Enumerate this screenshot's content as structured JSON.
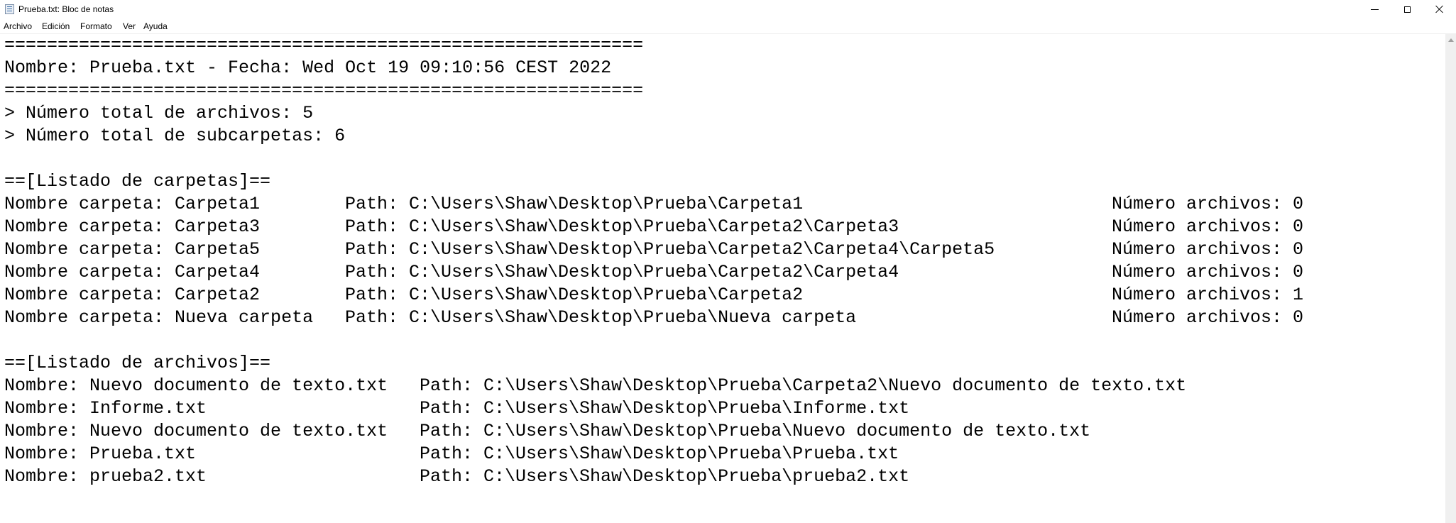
{
  "window": {
    "title": "Prueba.txt: Bloc de notas",
    "icon": "notepad-icon"
  },
  "menu": [
    "Archivo",
    "Edición",
    "Formato",
    "Ver",
    "Ayuda"
  ],
  "document": {
    "separator": "============================================================",
    "header": "Nombre: Prueba.txt - Fecha: Wed Oct 19 09:10:56 CEST 2022",
    "total_files": "> Número total de archivos: 5",
    "total_subfolders": "> Número total de subcarpetas: 6",
    "folders_heading": "==[Listado de carpetas]==",
    "folders": [
      {
        "name": "Nombre carpeta: Carpeta1",
        "path": "Path: C:\\Users\\Shaw\\Desktop\\Prueba\\Carpeta1",
        "count": "Número archivos: 0"
      },
      {
        "name": "Nombre carpeta: Carpeta3",
        "path": "Path: C:\\Users\\Shaw\\Desktop\\Prueba\\Carpeta2\\Carpeta3",
        "count": "Número archivos: 0"
      },
      {
        "name": "Nombre carpeta: Carpeta5",
        "path": "Path: C:\\Users\\Shaw\\Desktop\\Prueba\\Carpeta2\\Carpeta4\\Carpeta5",
        "count": "Número archivos: 0"
      },
      {
        "name": "Nombre carpeta: Carpeta4",
        "path": "Path: C:\\Users\\Shaw\\Desktop\\Prueba\\Carpeta2\\Carpeta4",
        "count": "Número archivos: 0"
      },
      {
        "name": "Nombre carpeta: Carpeta2",
        "path": "Path: C:\\Users\\Shaw\\Desktop\\Prueba\\Carpeta2",
        "count": "Número archivos: 1"
      },
      {
        "name": "Nombre carpeta: Nueva carpeta",
        "path": "Path: C:\\Users\\Shaw\\Desktop\\Prueba\\Nueva carpeta",
        "count": "Número archivos: 0"
      }
    ],
    "files_heading": "==[Listado de archivos]==",
    "files": [
      {
        "name": "Nombre: Nuevo documento de texto.txt",
        "path": "Path: C:\\Users\\Shaw\\Desktop\\Prueba\\Carpeta2\\Nuevo documento de texto.txt"
      },
      {
        "name": "Nombre: Informe.txt",
        "path": "Path: C:\\Users\\Shaw\\Desktop\\Prueba\\Informe.txt"
      },
      {
        "name": "Nombre: Nuevo documento de texto.txt",
        "path": "Path: C:\\Users\\Shaw\\Desktop\\Prueba\\Nuevo documento de texto.txt"
      },
      {
        "name": "Nombre: Prueba.txt",
        "path": "Path: C:\\Users\\Shaw\\Desktop\\Prueba\\Prueba.txt"
      },
      {
        "name": "Nombre: prueba2.txt",
        "path": "Path: C:\\Users\\Shaw\\Desktop\\Prueba\\prueba2.txt"
      }
    ]
  }
}
